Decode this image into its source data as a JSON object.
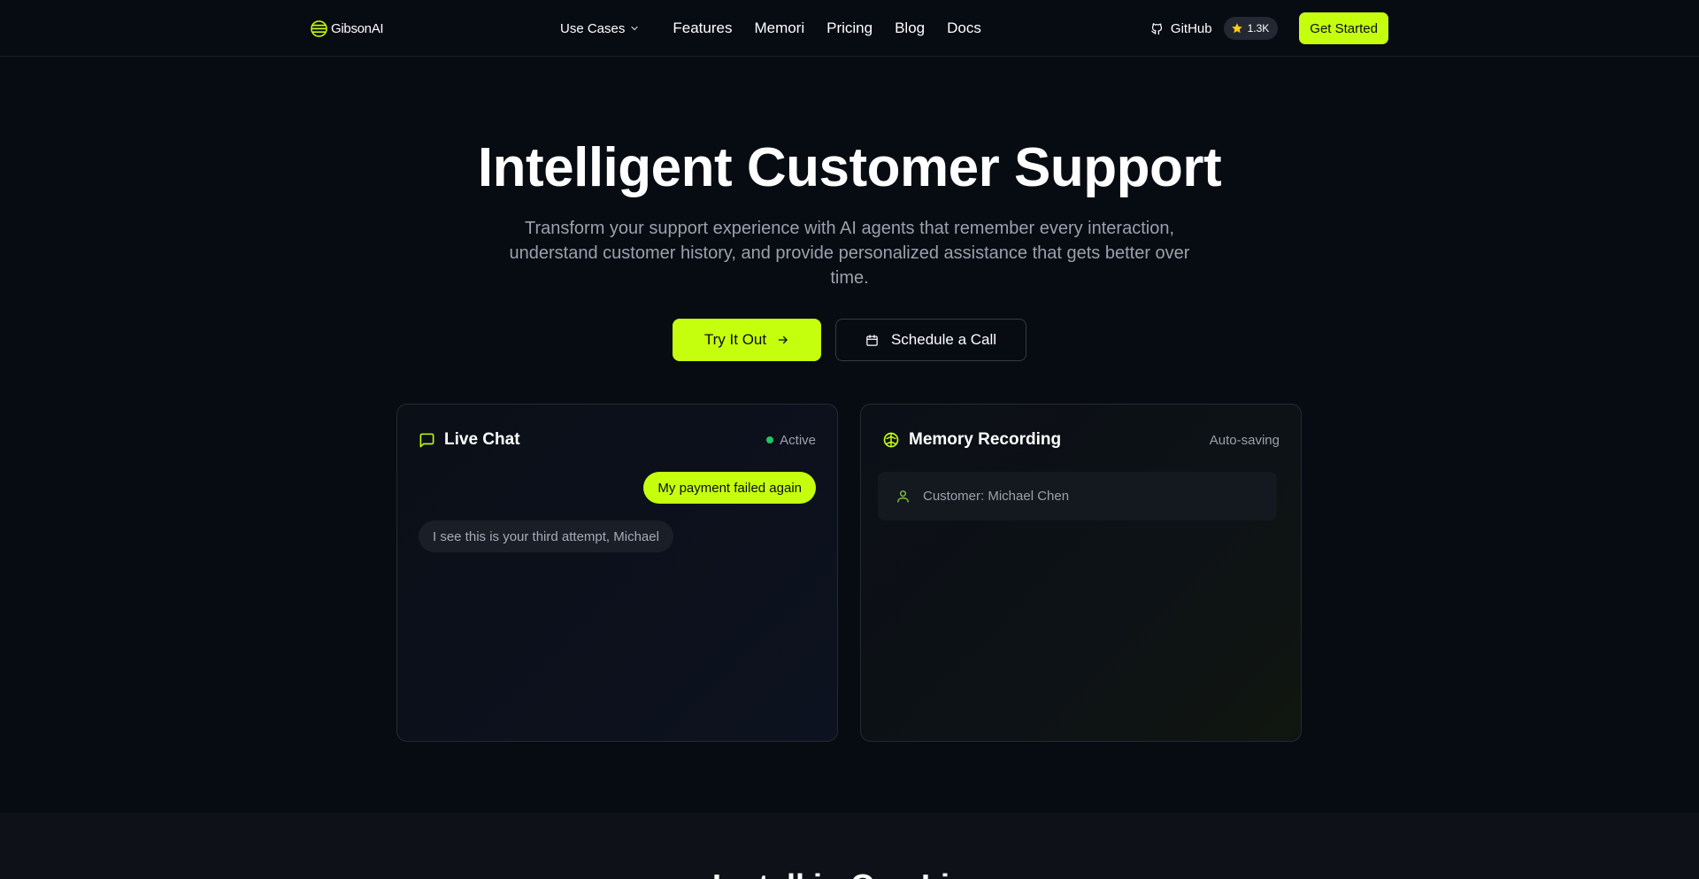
{
  "nav": {
    "brand": "GibsonAI",
    "use_cases": "Use Cases",
    "links": [
      "Features",
      "Memori",
      "Pricing",
      "Blog",
      "Docs"
    ],
    "github": "GitHub",
    "stars": "1.3K",
    "get_started": "Get Started"
  },
  "hero": {
    "title": "Intelligent Customer Support",
    "subtitle": "Transform your support experience with AI agents that remember every interaction, understand customer history, and provide personalized assistance that gets better over time.",
    "primary_cta": "Try It Out",
    "secondary_cta": "Schedule a Call"
  },
  "chat_card": {
    "title": "Live Chat",
    "status": "Active",
    "user_message": "My payment failed again",
    "agent_message": "I see this is your third attempt, Michael"
  },
  "memory_card": {
    "title": "Memory Recording",
    "status": "Auto-saving",
    "item": "Customer: Michael Chen"
  },
  "next_section": {
    "title": "Install in One Line"
  },
  "colors": {
    "accent": "#c5ff0e",
    "background": "#070b12",
    "active": "#22c55e"
  },
  "icons": [
    "gibson-logo-icon",
    "chevron-down-icon",
    "github-icon",
    "star-icon",
    "arrow-right-icon",
    "calendar-icon",
    "message-square-icon",
    "brain-icon",
    "user-icon"
  ]
}
